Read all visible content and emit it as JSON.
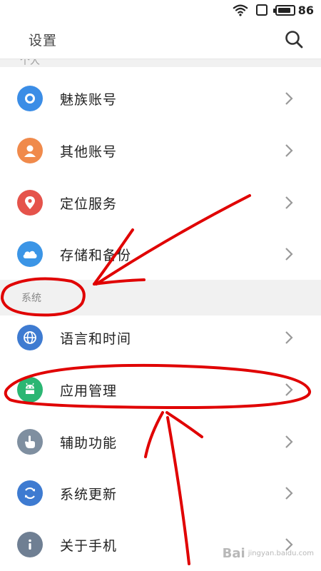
{
  "status_bar": {
    "battery_percent": "86",
    "battery_level": 0.86
  },
  "header": {
    "title": "设置"
  },
  "section_cut": {
    "label": "个人"
  },
  "section_system": {
    "label": "系统"
  },
  "items": [
    {
      "label": "魅族账号",
      "icon": "meizu-account-icon",
      "color": "#3b8de6"
    },
    {
      "label": "其他账号",
      "icon": "person-icon",
      "color": "#f08a4b"
    },
    {
      "label": "定位服务",
      "icon": "location-pin-icon",
      "color": "#e5534b"
    },
    {
      "label": "存储和备份",
      "icon": "cloud-icon",
      "color": "#3b95e6"
    },
    {
      "label": "语言和时间",
      "icon": "globe-icon",
      "color": "#3e7bd1"
    },
    {
      "label": "应用管理",
      "icon": "android-icon",
      "color": "#2bb673"
    },
    {
      "label": "辅助功能",
      "icon": "hand-icon",
      "color": "#7f8fa0"
    },
    {
      "label": "系统更新",
      "icon": "refresh-icon",
      "color": "#3e7bd1"
    },
    {
      "label": "关于手机",
      "icon": "info-icon",
      "color": "#6f7f93"
    }
  ],
  "watermark": {
    "text": "Bai",
    "sub": "jingyan.baidu.com"
  },
  "colors": {
    "annotation": "#e00000",
    "section_bg": "#f1f1f1",
    "chevron": "#999999"
  }
}
